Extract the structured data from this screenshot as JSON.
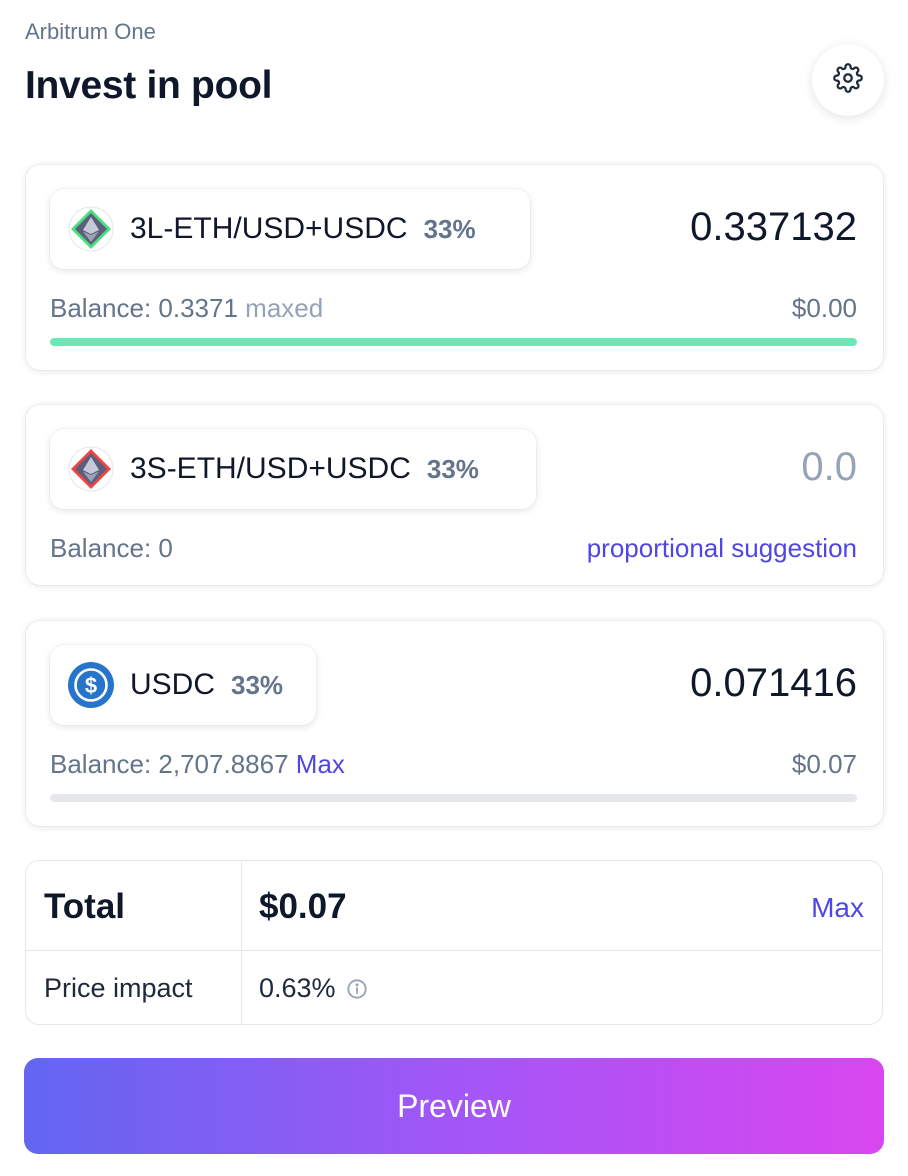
{
  "header": {
    "network": "Arbitrum One",
    "title": "Invest in pool"
  },
  "tokens": [
    {
      "symbol": "3L-ETH/USD+USDC",
      "weight": "33%",
      "amount": "0.337132",
      "balance_label": "Balance: 0.3371",
      "balance_note": "maxed",
      "fiat": "$0.00",
      "progress": 1.0,
      "icon": "eth-long-icon"
    },
    {
      "symbol": "3S-ETH/USD+USDC",
      "weight": "33%",
      "amount": "0.0",
      "balance_label": "Balance: 0",
      "suggestion": "proportional suggestion",
      "icon": "eth-short-icon"
    },
    {
      "symbol": "USDC",
      "weight": "33%",
      "amount": "0.071416",
      "balance_label": "Balance: 2,707.8867",
      "max_label": "Max",
      "fiat": "$0.07",
      "progress": 0.0,
      "icon": "usdc-icon"
    }
  ],
  "summary": {
    "total_label": "Total",
    "total_value": "$0.07",
    "max_label": "Max",
    "price_impact_label": "Price impact",
    "price_impact_value": "0.63%"
  },
  "preview_label": "Preview",
  "colors": {
    "accent": "#4f46e5",
    "progress_fill": "#6ee7b7",
    "gradient_start": "#6366f1",
    "gradient_end": "#d946ef"
  }
}
